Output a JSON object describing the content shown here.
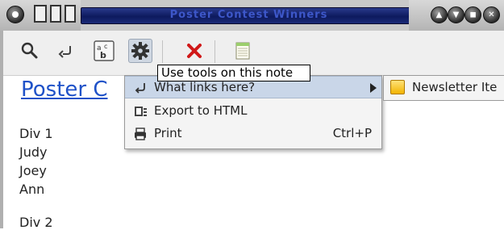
{
  "window": {
    "title": "Poster Contest Winners"
  },
  "toolbar": {
    "tools": [
      {
        "name": "search-icon"
      },
      {
        "name": "link-back-icon"
      },
      {
        "name": "spellcheck-icon"
      },
      {
        "name": "gear-icon"
      },
      {
        "name": "delete-icon"
      },
      {
        "name": "notebook-icon"
      }
    ],
    "tooltip": "Use tools on this note"
  },
  "note": {
    "title": "Poster C",
    "lines": [
      "Div 1",
      "Judy",
      "Joey",
      "Ann",
      "",
      "Div 2"
    ]
  },
  "menu": {
    "items": [
      {
        "label": "What links here?",
        "icon": "link-arrow-icon",
        "has_submenu": true
      },
      {
        "label": "Export to HTML",
        "icon": "export-html-icon"
      },
      {
        "label": "Print",
        "icon": "printer-icon",
        "accel": "Ctrl+P"
      }
    ]
  },
  "submenu": {
    "items": [
      {
        "label": "Newsletter Ite",
        "icon": "note-icon"
      }
    ]
  },
  "colors": {
    "title_bar": "#0d1a5e",
    "title_text": "#3d57c9",
    "link": "#1f52c8",
    "highlight": "#c9d6e8"
  }
}
